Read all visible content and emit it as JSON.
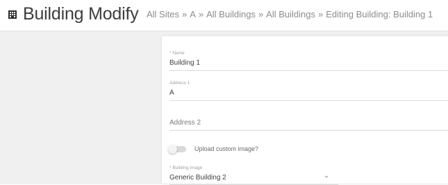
{
  "header": {
    "title": "Building Modify",
    "title_icon": "building-icon",
    "breadcrumb": {
      "items": [
        "All Sites",
        "A",
        "All Buildings",
        "All Buildings"
      ],
      "separator": "»",
      "current": "Editing Building: Building 1"
    }
  },
  "form": {
    "name": {
      "label": "* Name",
      "value": "Building 1"
    },
    "address1": {
      "label": "Address 1",
      "value": "A"
    },
    "address2": {
      "placeholder": "Address 2"
    },
    "upload_toggle": {
      "label": "Upload custom image?",
      "checked": false
    },
    "building_image": {
      "label": "* Building Image",
      "selected": "Generic Building 2",
      "icon": "chevron-down-icon"
    }
  },
  "colors": {
    "sidebar": "#303030",
    "content_background": "#f0f0f0",
    "card": "#ffffff"
  }
}
